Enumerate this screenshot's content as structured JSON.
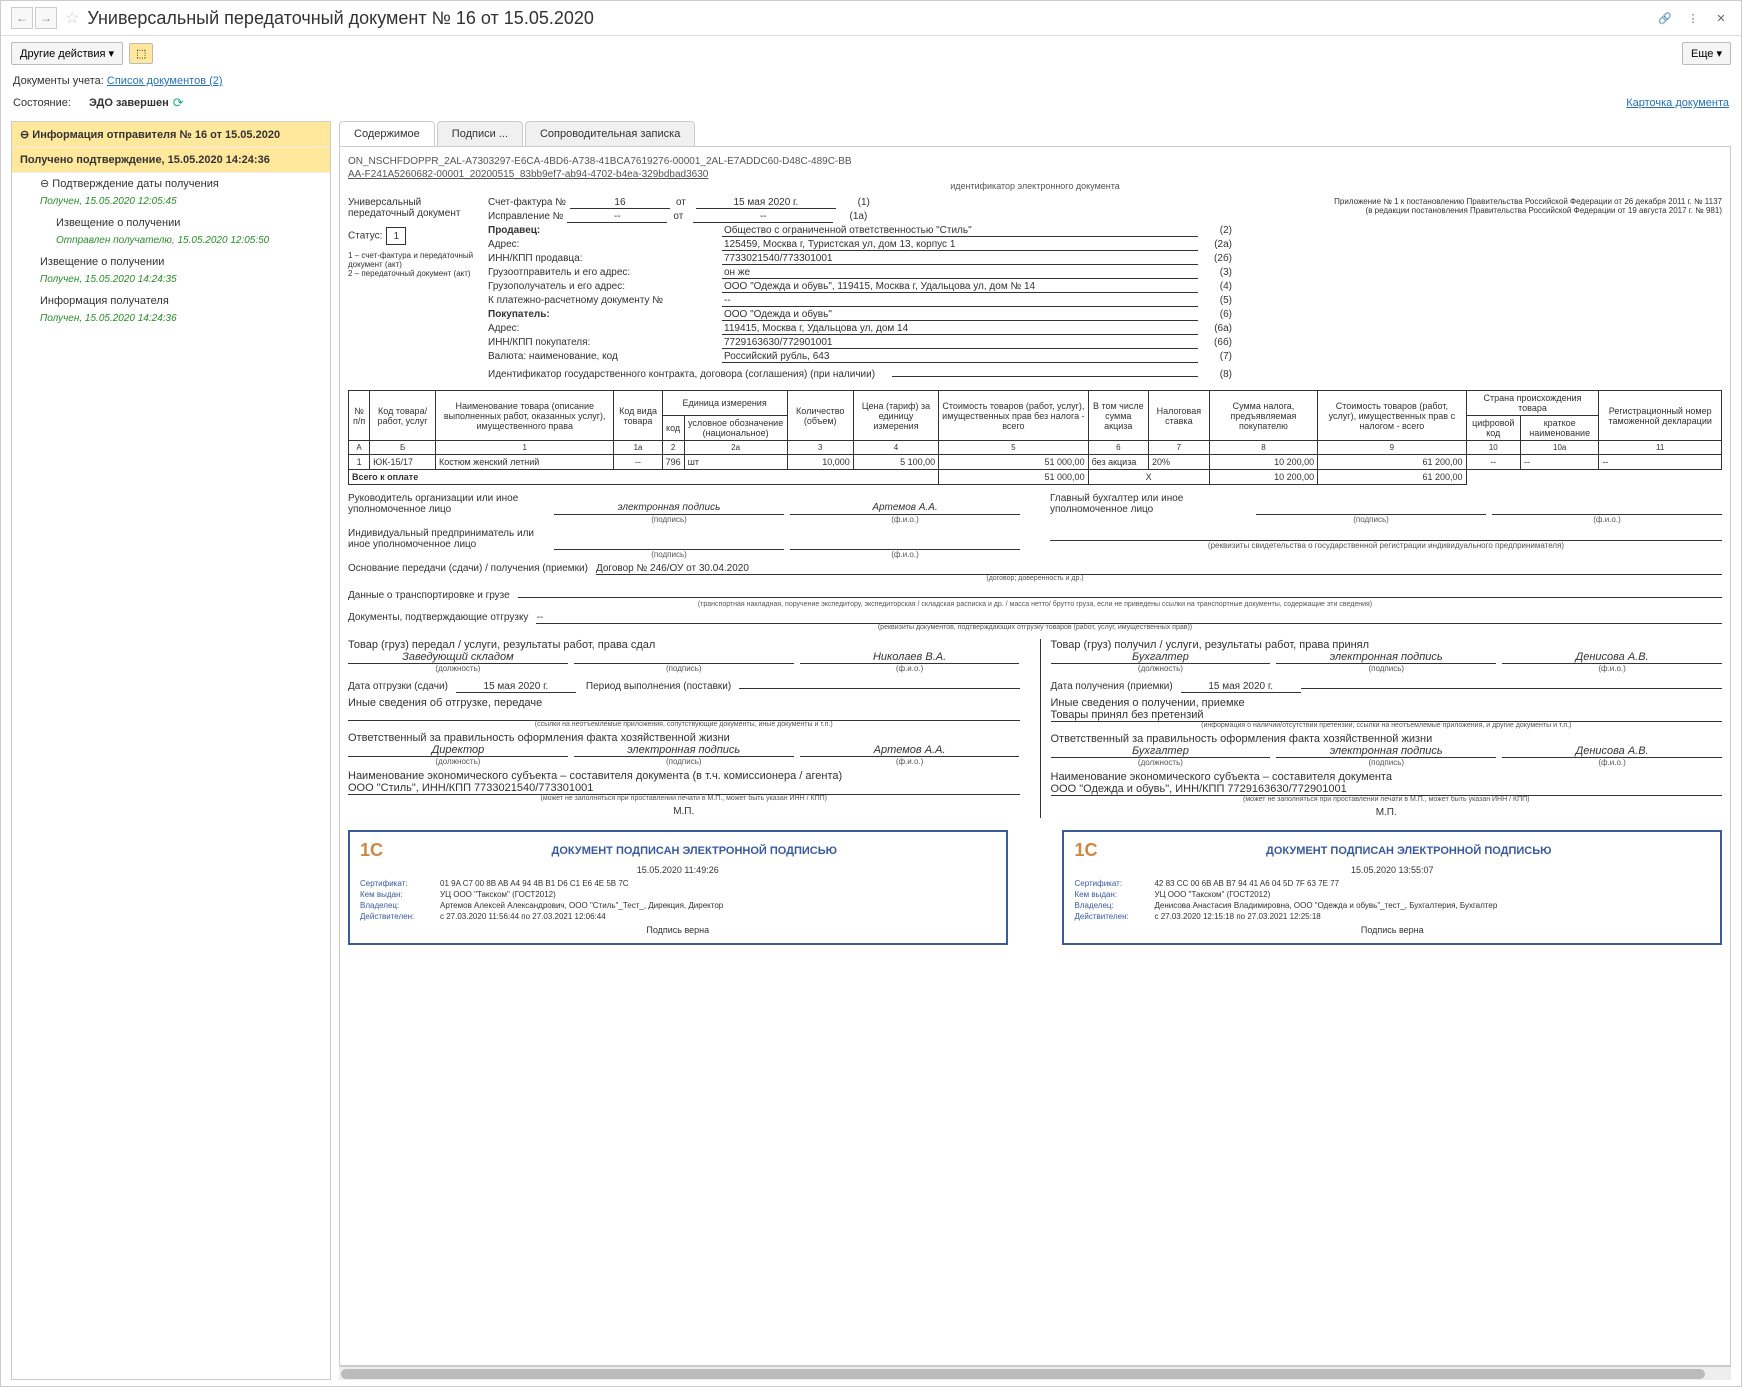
{
  "title": "Универсальный передаточный документ № 16 от 15.05.2020",
  "toolbar": {
    "other_actions": "Другие действия",
    "more": "Еще"
  },
  "docs_line": {
    "label": "Документы учета:",
    "link": "Список документов (2)"
  },
  "state": {
    "label": "Состояние:",
    "value": "ЭДО завершен",
    "card_link": "Карточка документа"
  },
  "sidebar": {
    "header": "Информация отправителя № 16 от 15.05.2020",
    "confirm": "Получено подтверждение, 15.05.2020 14:24:36",
    "items": [
      {
        "title": "Подтверждение даты получения",
        "status": "Получен, 15.05.2020 12:05:45"
      },
      {
        "title": "Извещение о получении",
        "status": "Отправлен получателю, 15.05.2020 12:05:50",
        "indent": true
      },
      {
        "title": "Извещение о получении",
        "status": "Получен, 15.05.2020 14:24:35"
      },
      {
        "title": "Информация получателя",
        "status": "Получен, 15.05.2020 14:24:36"
      }
    ]
  },
  "tabs": [
    "Содержимое",
    "Подписи ...",
    "Сопроводительная записка"
  ],
  "doc": {
    "id1": "ON_NSCHFDOPPR_2AL-A7303297-E6CA-4BD6-A738-41BCA7619276-00001_2AL-E7ADDC60-D48C-489C-BB",
    "id2": "AA-F241A5260682-00001_20200515_83bb9ef7-ab94-4702-b4ea-329bdbad3630",
    "id_label": "идентификатор электронного документа",
    "upd_label": "Универсальный передаточный документ",
    "status_label": "Статус:",
    "status_value": "1",
    "status_note": "1 – счет-фактура и передаточный документ (акт)\n2 – передаточный документ (акт)",
    "app_note1": "Приложение № 1 к постановлению Правительства Российской Федерации от 26 декабря 2011 г. № 1137",
    "app_note2": "(в редакции постановления Правительства Российской Федерации от 19 августа 2017 г. № 981)",
    "invoice": {
      "label": "Счет-фактура №",
      "num": "16",
      "from": "от",
      "date": "15 мая 2020 г.",
      "n": "(1)"
    },
    "correction": {
      "label": "Исправление №",
      "num": "--",
      "from": "от",
      "date": "--",
      "n": "(1а)"
    },
    "seller": {
      "label": "Продавец:",
      "value": "Общество с ограниченной ответственностью \"Стиль\"",
      "n": "(2)"
    },
    "seller_addr": {
      "label": "Адрес:",
      "value": "125459, Москва г, Туристская ул, дом 13, корпус 1",
      "n": "(2а)"
    },
    "seller_inn": {
      "label": "ИНН/КПП продавца:",
      "value": "7733021540/773301001",
      "n": "(2б)"
    },
    "shipper": {
      "label": "Грузоотправитель и его адрес:",
      "value": "он же",
      "n": "(3)"
    },
    "consignee": {
      "label": "Грузополучатель и его адрес:",
      "value": "ООО \"Одежда и обувь\", 119415, Москва г, Удальцова ул, дом № 14",
      "n": "(4)"
    },
    "payment": {
      "label": "К платежно-расчетному документу №",
      "value": "--",
      "n": "(5)"
    },
    "buyer": {
      "label": "Покупатель:",
      "value": "ООО \"Одежда и обувь\"",
      "n": "(6)"
    },
    "buyer_addr": {
      "label": "Адрес:",
      "value": "119415, Москва г, Удальцова ул, дом 14",
      "n": "(6а)"
    },
    "buyer_inn": {
      "label": "ИНН/КПП покупателя:",
      "value": "7729163630/772901001",
      "n": "(6б)"
    },
    "currency": {
      "label": "Валюта: наименование, код",
      "value": "Российский рубль, 643",
      "n": "(7)"
    },
    "contract": {
      "label": "Идентификатор государственного контракта, договора (соглашения) (при наличии)",
      "value": "",
      "n": "(8)"
    }
  },
  "table": {
    "headers": {
      "n": "№ п/п",
      "code": "Код товара/ работ, услуг",
      "name": "Наименование товара (описание выполненных работ, оказанных услуг), имущественного права",
      "kind": "Код вида товара",
      "unit": "Единица измерения",
      "unit_code": "код",
      "unit_name": "условное обозначение (национальное)",
      "qty": "Количество (объем)",
      "price": "Цена (тариф) за единицу измерения",
      "cost": "Стоимость товаров (работ, услуг), имущественных прав без налога - всего",
      "excise": "В том числе сумма акциза",
      "rate": "Налоговая ставка",
      "tax": "Сумма налога, предъявляемая покупателю",
      "total": "Стоимость товаров (работ, услуг), имущественных прав с налогом - всего",
      "country": "Страна происхождения товара",
      "country_code": "цифровой код",
      "country_name": "краткое наименование",
      "decl": "Регистрационный номер таможенной декларации"
    },
    "num_row": [
      "А",
      "Б",
      "1",
      "1а",
      "2",
      "2а",
      "3",
      "4",
      "5",
      "6",
      "7",
      "8",
      "9",
      "10",
      "10а",
      "11"
    ],
    "rows": [
      {
        "n": "1",
        "code": "ЮК-15/17",
        "name": "Костюм женский летний",
        "kind": "--",
        "ucode": "796",
        "uname": "шт",
        "qty": "10,000",
        "price": "5 100,00",
        "cost": "51 000,00",
        "excise": "без акциза",
        "rate": "20%",
        "tax": "10 200,00",
        "total": "61 200,00",
        "ccode": "--",
        "cname": "--",
        "decl": "--"
      }
    ],
    "total_label": "Всего к оплате",
    "total": {
      "cost": "51 000,00",
      "tax": "10 200,00",
      "total": "61 200,00",
      "x": "Х"
    }
  },
  "sig": {
    "head": {
      "label1": "Руководитель организации или иное уполномоченное лицо",
      "sign": "электронная подпись",
      "fio": "Артемов А.А.",
      "label2": "Главный бухгалтер или иное уполномоченное лицо"
    },
    "ip": "Индивидуальный предприниматель или иное уполномоченное лицо",
    "cap_sign": "(подпись)",
    "cap_fio": "(ф.и.о.)",
    "cap_ip": "(реквизиты свидетельства о государственной  регистрации индивидуального предпринимателя)"
  },
  "basis": {
    "label": "Основание передачи (сдачи) / получения (приемки)",
    "value": "Договор № 246/ОУ от 30.04.2020",
    "cap": "(договор; доверенность и др.)"
  },
  "transport": {
    "label": "Данные о транспортировке и грузе",
    "value": "",
    "cap": "(транспортная накладная, поручение экспедитору, экспедиторская / складская расписка и др. / масса нетто/ брутто груза, если не приведены ссылки на транспортные документы, содержащие эти сведения)"
  },
  "confirm_docs": {
    "label": "Документы, подтверждающие отгрузку",
    "value": "--",
    "cap": "(реквизиты документов, подтверждающих отгрузку товаров (работ, услуг, имущественных прав))"
  },
  "left_block": {
    "title": "Товар (груз) передал / услуги, результаты работ, права сдал",
    "role": "Заведующий складом",
    "fio": "Николаев В.А.",
    "date_label": "Дата отгрузки (сдачи)",
    "date": "15 мая 2020 г.",
    "period_label": "Период выполнения (поставки)",
    "other": "Иные сведения об отгрузке, передаче",
    "other_cap": "(ссылки на неотъемлемые приложения, сопутствующие документы, иные документы и т.п.)",
    "resp": "Ответственный за правильность оформления факта хозяйственной жизни",
    "resp_role": "Директор",
    "resp_sign": "электронная подпись",
    "resp_fio": "Артемов А.А.",
    "econ": "Наименование экономического субъекта – составителя документа (в т.ч. комиссионера / агента)",
    "econ_val": "ООО \"Стиль\", ИНН/КПП 7733021540/773301001",
    "econ_cap": "(может не заполняться при проставлении печати в М.П., может быть указан ИНН / КПП)",
    "mp": "М.П."
  },
  "right_block": {
    "title": "Товар (груз) получил / услуги, результаты работ, права принял",
    "role": "Бухгалтер",
    "sign": "электронная подпись",
    "fio": "Денисова А.В.",
    "date_label": "Дата получения (приемки)",
    "date": "15 мая 2020 г.",
    "other": "Иные сведения о получении, приемке",
    "claims": "Товары принял без претензий",
    "claims_cap": "(информация о наличии/отсутствии претензии; ссылки на неотъемлемые приложения, и другие  документы и т.п.)",
    "resp": "Ответственный за правильность оформления факта хозяйственной жизни",
    "resp_role": "Бухгалтер",
    "resp_sign": "электронная подпись",
    "resp_fio": "Денисова А.В.",
    "econ": "Наименование экономического субъекта – составителя документа",
    "econ_val": "ООО \"Одежда и обувь\", ИНН/КПП 7729163630/772901001",
    "econ_cap": "(может не заполняться при проставлении печати в М.П., может быть указан ИНН / КПП)",
    "mp": "М.П."
  },
  "caps": {
    "role": "(должность)",
    "sign": "(подпись)",
    "fio": "(ф.и.о.)"
  },
  "stamps": [
    {
      "title": "ДОКУМЕНТ ПОДПИСАН ЭЛЕКТРОННОЙ ПОДПИСЬЮ",
      "date": "15.05.2020 11:49:26",
      "cert_l": "Сертификат:",
      "cert": "01 9A C7 00 8B AB A4 94 4B B1 D6 C1 E6 4E 5B 7C",
      "issuer_l": "Кем выдан:",
      "issuer": "УЦ ООО \"Такском\" (ГОСТ2012)",
      "owner_l": "Владелец:",
      "owner": "Артемов Алексей Александрович, ООО \"Стиль\"_Тест_, Дирекция, Директор",
      "valid_l": "Действителен:",
      "valid": "с 27.03.2020 11:56:44 по 27.03.2021 12:06:44",
      "footer": "Подпись верна"
    },
    {
      "title": "ДОКУМЕНТ ПОДПИСАН ЭЛЕКТРОННОЙ ПОДПИСЬЮ",
      "date": "15.05.2020 13:55:07",
      "cert_l": "Сертификат:",
      "cert": "42 83 CC 00 6B AB B7 94 41 A6 04 5D 7F 63 7E 77",
      "issuer_l": "Кем выдан:",
      "issuer": "УЦ ООО \"Такском\" (ГОСТ2012)",
      "owner_l": "Владелец:",
      "owner": "Денисова Анастасия Владимировна, ООО \"Одежда и обувь\"_тест_, Бухгалтерия, Бухгалтер",
      "valid_l": "Действителен:",
      "valid": "с 27.03.2020 12:15:18 по 27.03.2021 12:25:18",
      "footer": "Подпись верна"
    }
  ]
}
